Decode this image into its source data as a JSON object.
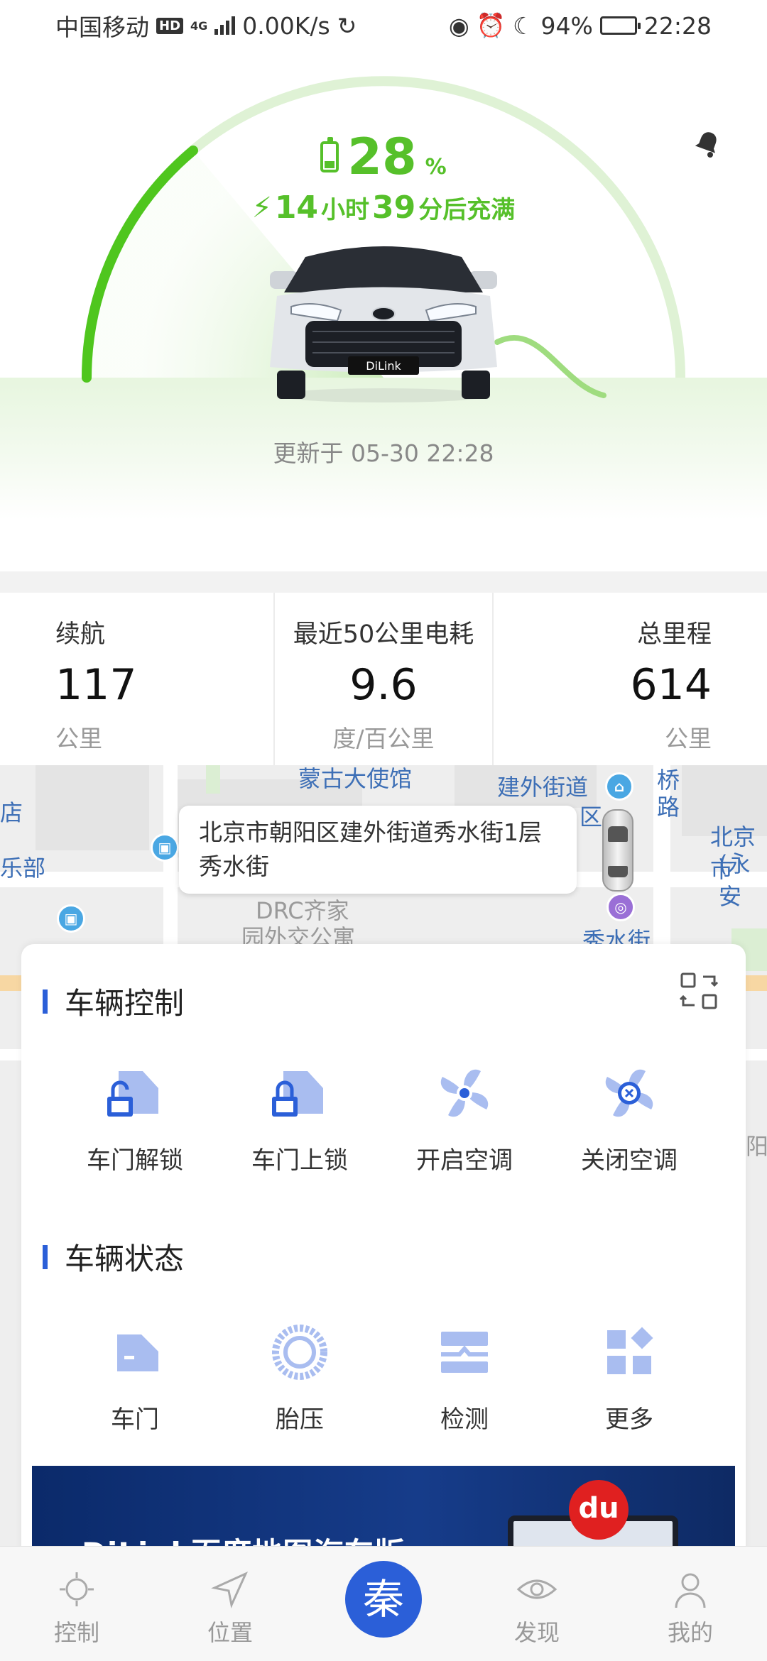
{
  "status_bar": {
    "carrier": "中国移动",
    "hd": "HD",
    "network": "4G",
    "speed": "0.00K/s",
    "battery_pct": "94%",
    "time": "22:28"
  },
  "hero": {
    "battery_percent": "28",
    "percent_unit": "%",
    "battery_level": 0.28,
    "charge_hours": "14",
    "hours_unit": "小时",
    "charge_minutes": "39",
    "minutes_suffix": "分后充满",
    "car_badge": "DiLink",
    "updated_label": "更新于 05-30 22:28"
  },
  "stats": [
    {
      "label": "续航",
      "value": "117",
      "unit": "公里"
    },
    {
      "label": "最近50公里电耗",
      "value": "9.6",
      "unit": "度/百公里"
    },
    {
      "label": "总里程",
      "value": "614",
      "unit": "公里"
    }
  ],
  "map": {
    "address": "北京市朝阳区建外街道秀水街1层秀水街",
    "labels": {
      "embassy": "蒙古大使馆",
      "jianwai": "建外街道",
      "district": "区",
      "bridge": "桥",
      "road": "路",
      "beijing_left": "北京市",
      "yong": "(永安",
      "dian": "店",
      "bu": "乐部",
      "drc_1": "DRC齐家",
      "drc_2": "园外交公寓",
      "xiushui": "秀水街",
      "yang": "阳"
    }
  },
  "vehicle_control": {
    "title": "车辆控制",
    "items": [
      {
        "label": "车门解锁",
        "icon": "door-unlock-icon"
      },
      {
        "label": "车门上锁",
        "icon": "door-lock-icon"
      },
      {
        "label": "开启空调",
        "icon": "ac-on-icon"
      },
      {
        "label": "关闭空调",
        "icon": "ac-off-icon"
      }
    ]
  },
  "vehicle_status": {
    "title": "车辆状态",
    "items": [
      {
        "label": "车门",
        "icon": "door-icon"
      },
      {
        "label": "胎压",
        "icon": "tire-icon"
      },
      {
        "label": "检测",
        "icon": "inspection-icon"
      },
      {
        "label": "更多",
        "icon": "more-icon"
      }
    ]
  },
  "banner": {
    "text": "DiLink百度地图汽车版",
    "badge": "du"
  },
  "bottom_nav": [
    {
      "label": "控制",
      "icon": "control-icon"
    },
    {
      "label": "位置",
      "icon": "location-icon"
    },
    {
      "label": "秦",
      "icon": "qin-logo"
    },
    {
      "label": "发现",
      "icon": "discover-icon"
    },
    {
      "label": "我的",
      "icon": "profile-icon"
    }
  ],
  "colors": {
    "accent_green": "#56c02a",
    "accent_blue": "#2b5fd8",
    "icon_light_blue": "#a9bdf0"
  }
}
